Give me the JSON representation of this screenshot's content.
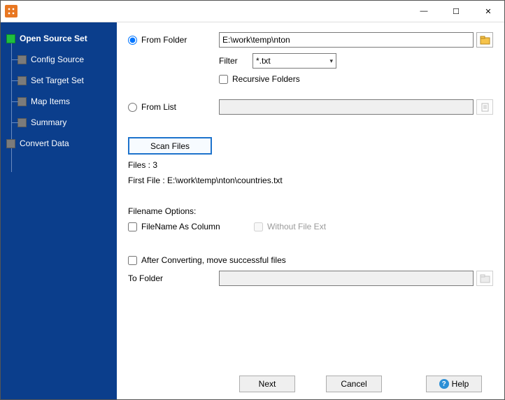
{
  "sidebar": {
    "items": [
      {
        "label": "Open Source Set",
        "active": true,
        "child": false
      },
      {
        "label": "Config Source",
        "active": false,
        "child": true
      },
      {
        "label": "Set Target Set",
        "active": false,
        "child": true
      },
      {
        "label": "Map Items",
        "active": false,
        "child": true
      },
      {
        "label": "Summary",
        "active": false,
        "child": true
      },
      {
        "label": "Convert Data",
        "active": false,
        "child": false
      }
    ]
  },
  "form": {
    "from_folder_label": "From Folder",
    "from_folder_value": "E:\\work\\temp\\nton",
    "filter_label": "Filter",
    "filter_value": "*.txt",
    "recursive_label": "Recursive Folders",
    "from_list_label": "From List",
    "from_list_value": "",
    "scan_button": "Scan Files",
    "files_count_text": "Files : 3",
    "first_file_text": "First File : E:\\work\\temp\\nton\\countries.txt",
    "filename_options_label": "Filename Options:",
    "filename_as_column_label": "FileName As Column",
    "without_ext_label": "Without File Ext",
    "after_convert_label": "After Converting, move successful files",
    "to_folder_label": "To Folder",
    "to_folder_value": ""
  },
  "buttons": {
    "next": "Next",
    "cancel": "Cancel",
    "help": "Help"
  }
}
